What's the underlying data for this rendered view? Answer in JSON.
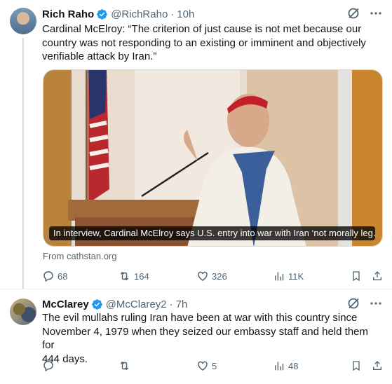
{
  "tweets": [
    {
      "author_name": "Rich Raho",
      "handle": "@RichRaho",
      "time": "10h",
      "text": "Cardinal McElroy: “The criterion of just cause is not met because our\ncountry was not responding to an existing or imminent and objectively\nverifiable attack by Iran.”",
      "media_caption": "In interview, Cardinal McElroy says U.S. entry into war with Iran ‘not morally leg...",
      "source": "From cathstan.org",
      "stats": {
        "replies": "68",
        "reposts": "164",
        "likes": "326",
        "views": "11K"
      }
    },
    {
      "author_name": "McClarey",
      "handle": "@McClarey2",
      "time": "7h",
      "text": "The evil mullahs ruling Iran have been at war with this country since\nNovember 4, 1979 when they seized our embassy staff and held them for\n444 days.",
      "stats": {
        "replies": "",
        "reposts": "",
        "likes": "5",
        "views": "48"
      }
    }
  ],
  "colors": {
    "verified": "#1d9bf0",
    "secondary_text": "#536471",
    "divider": "#eff3f4"
  },
  "icons": [
    "verified-badge-icon",
    "grok-icon",
    "more-icon",
    "reply-icon",
    "repost-icon",
    "like-icon",
    "views-icon",
    "bookmark-icon",
    "share-icon"
  ]
}
